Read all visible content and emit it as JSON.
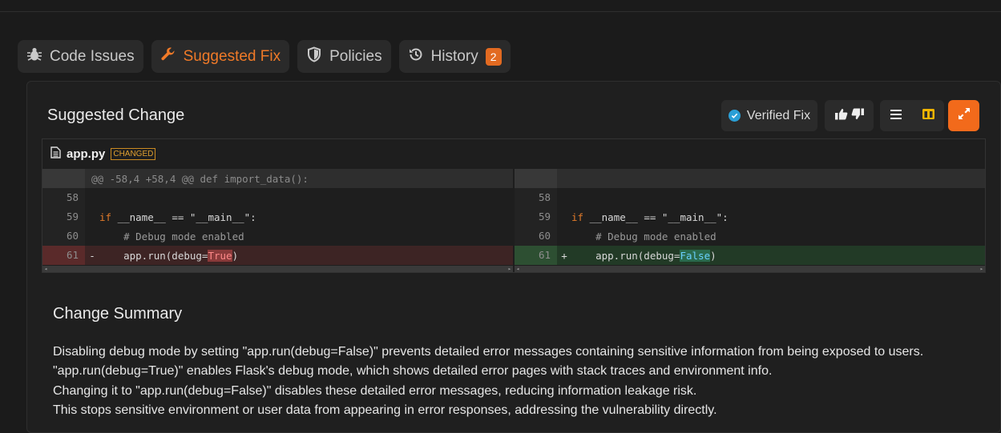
{
  "tabs": [
    {
      "label": "Code Issues",
      "icon": "bug-icon"
    },
    {
      "label": "Suggested Fix",
      "icon": "wrench-icon"
    },
    {
      "label": "Policies",
      "icon": "shield-icon"
    },
    {
      "label": "History",
      "icon": "history-icon",
      "badge": "2"
    }
  ],
  "panel": {
    "title": "Suggested Change",
    "verified_label": "Verified Fix"
  },
  "diff": {
    "file_name": "app.py",
    "status_badge": "CHANGED",
    "hunk_header": "@@ -58,4 +58,4 @@ def import_data():",
    "left": {
      "lines": [
        {
          "num": "58",
          "sign": "",
          "code": ""
        },
        {
          "num": "59",
          "sign": "",
          "kw": "if",
          "code": " __name__ == \"__main__\":"
        },
        {
          "num": "60",
          "sign": "",
          "comment": "    # Debug mode enabled"
        },
        {
          "num": "61",
          "sign": "-",
          "pre": "    app.run(debug=",
          "hl": "True",
          "post": ")"
        }
      ]
    },
    "right": {
      "lines": [
        {
          "num": "58",
          "sign": "",
          "code": ""
        },
        {
          "num": "59",
          "sign": "",
          "kw": "if",
          "code": " __name__ == \"__main__\":"
        },
        {
          "num": "60",
          "sign": "",
          "comment": "    # Debug mode enabled"
        },
        {
          "num": "61",
          "sign": "+",
          "pre": "    app.run(debug=",
          "hl": "False",
          "post": ")"
        }
      ]
    }
  },
  "summary": {
    "title": "Change Summary",
    "lines": [
      "Disabling debug mode by setting \"app.run(debug=False)\" prevents detailed error messages containing sensitive information from being exposed to users.",
      "\"app.run(debug=True)\" enables Flask's debug mode, which shows detailed error pages with stack traces and environment info.",
      "Changing it to \"app.run(debug=False)\" disables these detailed error messages, reducing information leakage risk.",
      "This stops sensitive environment or user data from appearing in error responses, addressing the vulnerability directly."
    ]
  },
  "colors": {
    "accent": "#f26a1b",
    "deleted_bg": "#3d2424",
    "added_bg": "#223a26",
    "verified": "#2a9fd6"
  }
}
